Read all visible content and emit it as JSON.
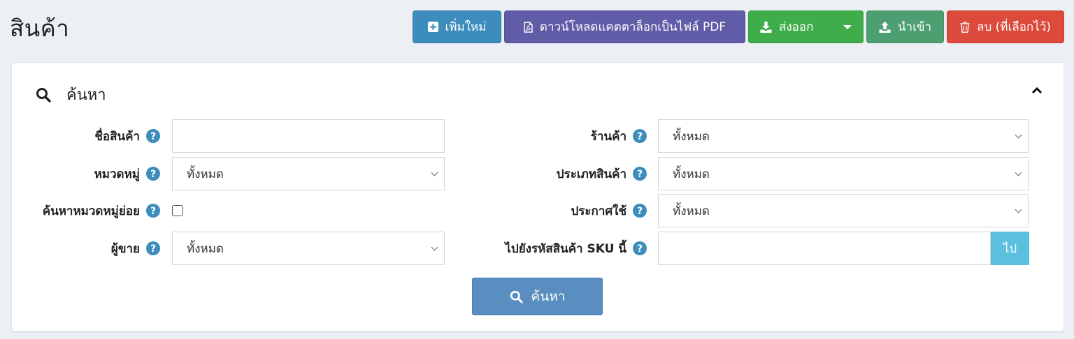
{
  "page": {
    "title": "สินค้า"
  },
  "toolbar": {
    "add_label": "เพิ่มใหม่",
    "pdf_label": "ดาวน์โหลดแคตตาล็อกเป็นไฟล์ PDF",
    "export_label": "ส่งออก",
    "import_label": "นำเข้า",
    "delete_label": "ลบ (ที่เลือกไว้)"
  },
  "search_box": {
    "title": "ค้นหา",
    "fields": {
      "product_name": {
        "label": "ชื่อสินค้า",
        "value": ""
      },
      "category": {
        "label": "หมวดหมู่",
        "value": "ทั้งหมด"
      },
      "subcategory": {
        "label": "ค้นหาหมวดหมู่ย่อย",
        "checked": false
      },
      "seller": {
        "label": "ผู้ขาย",
        "value": "ทั้งหมด"
      },
      "shop": {
        "label": "ร้านค้า",
        "value": "ทั้งหมด"
      },
      "product_type": {
        "label": "ประเภทสินค้า",
        "value": "ทั้งหมด"
      },
      "published": {
        "label": "ประกาศใช้",
        "value": "ทั้งหมด"
      },
      "sku_goto": {
        "label": "ไปยังรหัสสินค้า SKU นี้",
        "value": "",
        "button": "ไป"
      }
    },
    "search_button": "ค้นหา"
  },
  "colors": {
    "add": "#3c8dbc",
    "pdf": "#605ca8",
    "export": "#40ad4b",
    "import": "#4d9f72",
    "delete": "#dc4a3c",
    "help": "#3c8dbc",
    "go": "#5bc0de"
  }
}
